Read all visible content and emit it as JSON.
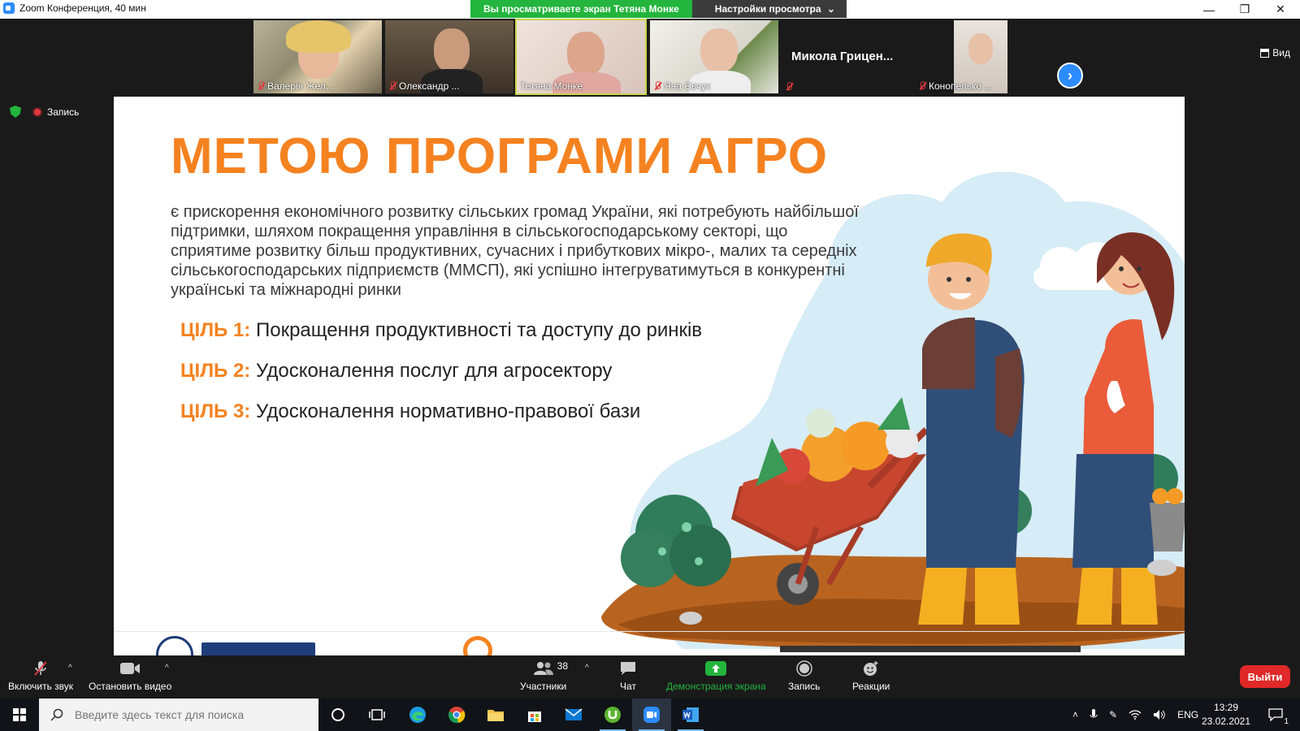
{
  "window": {
    "title": "Zoom Конференция, 40 мин",
    "minimize": "—",
    "restore": "❐",
    "close": "✕"
  },
  "share_banner": {
    "viewing_text": "Вы просматриваете экран Тетяна Монке",
    "settings_label": "Настройки просмотра",
    "settings_caret": "⌄"
  },
  "participants_strip": {
    "tiles": [
      {
        "name": "Валерія Жел...",
        "muted": true
      },
      {
        "name": "Олександр ...",
        "muted": true
      },
      {
        "name": "Тетяна Монке",
        "muted": false,
        "active": true
      },
      {
        "name": "Яна Євчук",
        "muted": true
      },
      {
        "name": "Микола  Грицен...",
        "muted": true,
        "video": false
      },
      {
        "name": "Конопелько ...",
        "muted": true
      }
    ],
    "next_glyph": "›",
    "view_label": "Вид"
  },
  "status": {
    "record_label": "Запись"
  },
  "slide": {
    "title": "МЕТОЮ ПРОГРАМИ АГРО",
    "body": "є прискорення економічного розвитку сільських громад України, які потребують найбільшої підтримки, шляхом покращення управління в сільськогосподарському секторі, що сприятиме розвитку більш продуктивних, сучасних і прибуткових мікро-, малих та середніх сільськогосподарських підприємств (ММСП), які успішно інтегруватимуться в конкурентні українські та міжнародні ринки",
    "goals": [
      {
        "label": "ЦІЛЬ 1:",
        "text": " Покращення продуктивності та доступу до ринків"
      },
      {
        "label": "ЦІЛЬ 2:",
        "text": " Удосконалення послуг для агросектору"
      },
      {
        "label": "ЦІЛЬ 3:",
        "text": " Удосконалення нормативно-правової бази"
      }
    ]
  },
  "toolbar": {
    "unmute_label": "Включить звук",
    "stop_video_label": "Остановить видео",
    "participants_label": "Участники",
    "participants_count": "38",
    "chat_label": "Чат",
    "share_label": "Демонстрация экрана",
    "record_label": "Запись",
    "reactions_label": "Реакции",
    "leave_label": "Выйти",
    "caret": "^"
  },
  "taskbar": {
    "search_placeholder": "Введите здесь текст для поиска",
    "language": "ENG",
    "time": "13:29",
    "date": "23.02.2021",
    "notifications": "1"
  },
  "colors": {
    "accent_orange": "#f58220",
    "zoom_blue": "#2d8cff",
    "share_green": "#23b53d",
    "leave_red": "#e02828",
    "mute_red": "#e0393e"
  }
}
